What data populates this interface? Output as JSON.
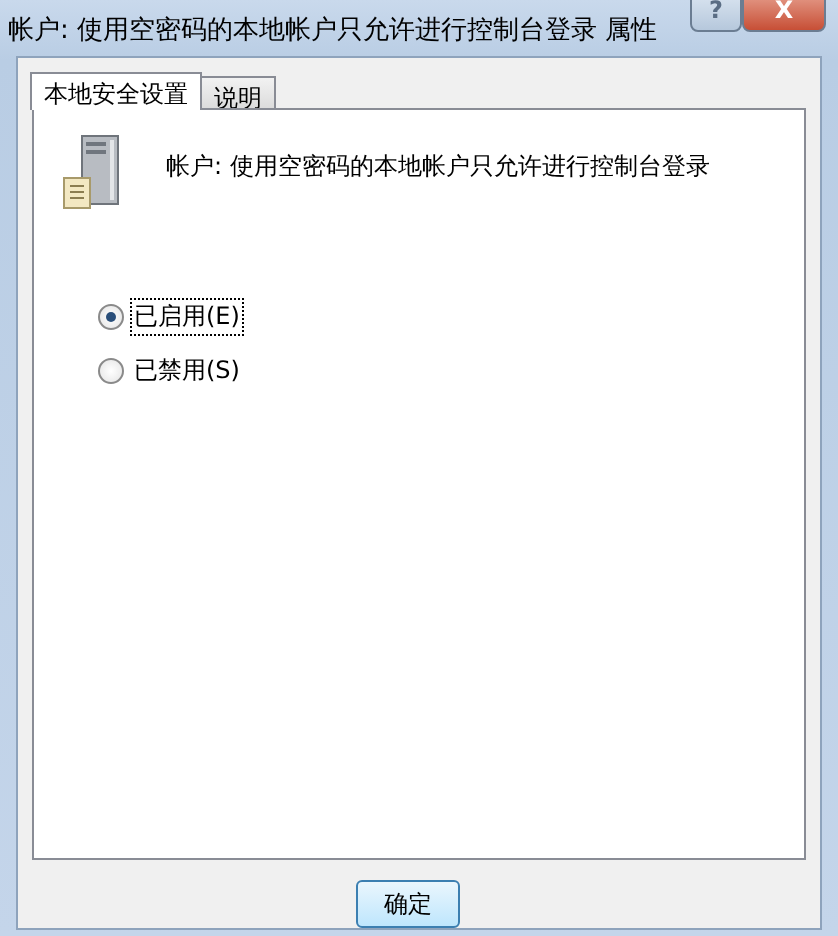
{
  "window": {
    "title": "帐户: 使用空密码的本地帐户只允许进行控制台登录 属性",
    "controls": [
      {
        "kind": "help",
        "label": "?"
      },
      {
        "kind": "close",
        "label": "X"
      }
    ]
  },
  "tabs": [
    {
      "label": "本地安全设置",
      "selected": true
    },
    {
      "label": "说明",
      "selected": false
    }
  ],
  "policy": {
    "title": "帐户: 使用空密码的本地帐户只允许进行控制台登录"
  },
  "options": [
    {
      "label": "已启用(E)",
      "selected": true
    },
    {
      "label": "已禁用(S)",
      "selected": false
    }
  ],
  "buttons": [
    "确定"
  ]
}
